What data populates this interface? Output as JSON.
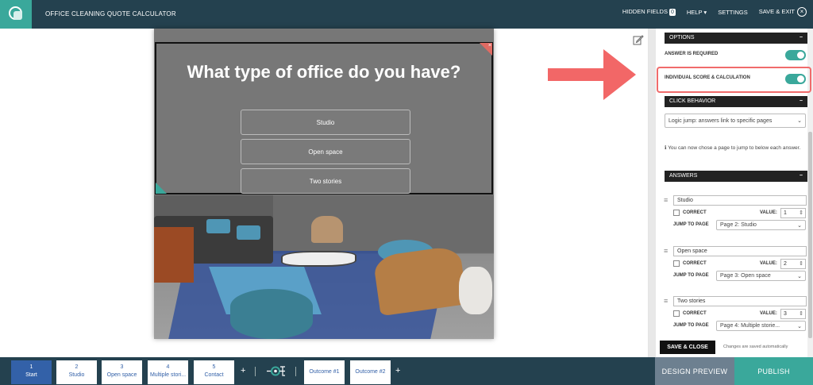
{
  "header": {
    "title": "OFFICE CLEANING QUOTE CALCULATOR",
    "hidden_fields_label": "HIDDEN FIELDS",
    "hidden_fields_count": "0",
    "help_label": "HELP",
    "settings_label": "SETTINGS",
    "save_exit_label": "SAVE & EXIT"
  },
  "preview": {
    "question": "What type of office do you have?",
    "answers": [
      "Studio",
      "Open space",
      "Two stories"
    ]
  },
  "panel": {
    "options_header": "OPTIONS",
    "answer_required_label": "ANSWER IS REQUIRED",
    "answer_required_on": true,
    "individual_score_label": "INDIVIDUAL SCORE & CALCULATION",
    "individual_score_on": true,
    "click_behavior_header": "CLICK BEHAVIOR",
    "click_behavior_value": "Logic jump: answers link to specific pages",
    "info_text": "You can now chose a page to jump to below each answer.",
    "answers_header": "ANSWERS",
    "correct_label": "CORRECT",
    "value_label": "VALUE:",
    "jump_label": "JUMP TO PAGE",
    "answers": [
      {
        "text": "Studio",
        "value": "1",
        "jump": "Page 2: Studio"
      },
      {
        "text": "Open space",
        "value": "2",
        "jump": "Page 3: Open space"
      },
      {
        "text": "Two stories",
        "value": "3",
        "jump": "Page 4: Multiple storie..."
      }
    ],
    "save_close_label": "SAVE & CLOSE",
    "save_note": "Changes are saved automatically"
  },
  "bottom": {
    "pages": [
      {
        "num": "1",
        "name": "Start"
      },
      {
        "num": "2",
        "name": "Studio"
      },
      {
        "num": "3",
        "name": "Open space"
      },
      {
        "num": "4",
        "name": "Multiple stori..."
      },
      {
        "num": "5",
        "name": "Contact"
      }
    ],
    "outcomes": [
      "Outcome #1",
      "Outcome #2"
    ],
    "design_preview_label": "DESIGN PREVIEW",
    "publish_label": "PUBLISH"
  },
  "colors": {
    "header_bg": "#24414f",
    "accent": "#3aa89b",
    "highlight": "#f06b6b",
    "page_blue": "#3361a8"
  }
}
